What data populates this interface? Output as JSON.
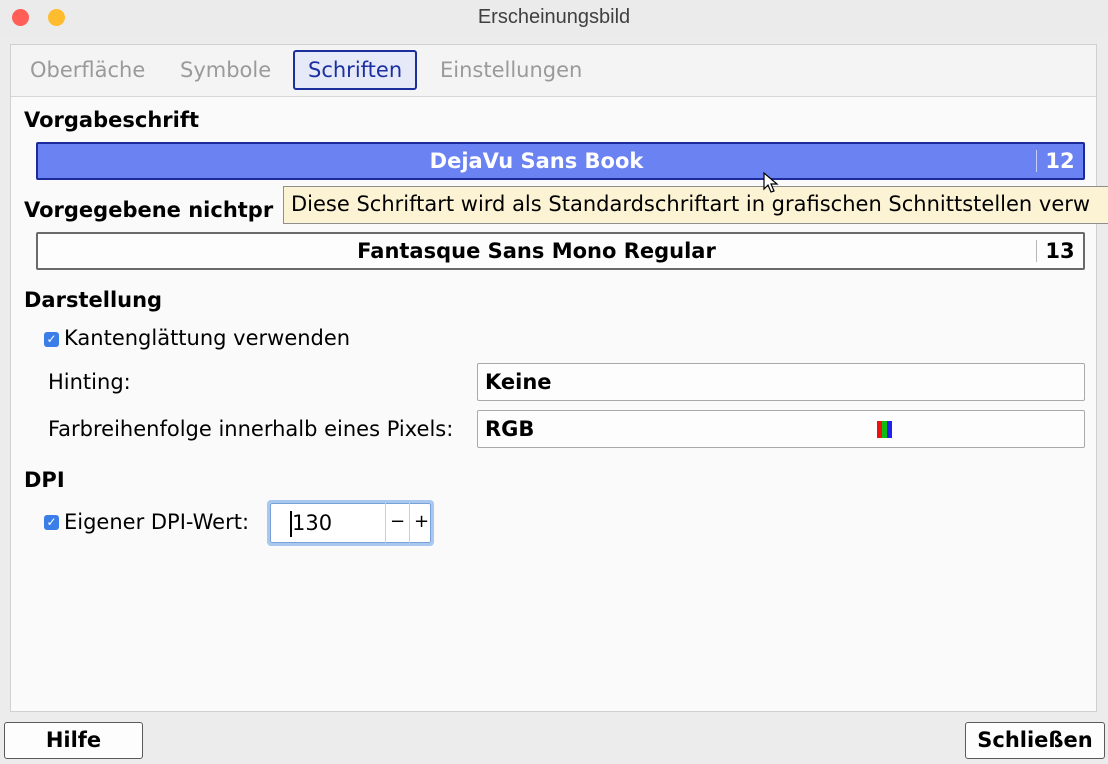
{
  "window": {
    "title": "Erscheinungsbild"
  },
  "tabs": [
    {
      "label": "Oberfläche"
    },
    {
      "label": "Symbole"
    },
    {
      "label": "Schriften",
      "active": true
    },
    {
      "label": "Einstellungen"
    }
  ],
  "default_font": {
    "heading": "Vorgabeschrift",
    "name": "DejaVu Sans Book",
    "size": "12"
  },
  "monospace_font": {
    "heading": "Vorgegebene nichtpr",
    "name": "Fantasque Sans Mono Regular",
    "size": "13"
  },
  "tooltip": {
    "text": "Diese Schriftart wird als Standardschriftart in grafischen Schnittstellen verw"
  },
  "rendering": {
    "heading": "Darstellung",
    "antialias_label": "Kantenglättung verwenden",
    "antialias_checked": true,
    "hinting_label": "Hinting:",
    "hinting_value": "Keine",
    "subpixel_label": "Farbreihenfolge innerhalb eines Pixels:",
    "subpixel_value": "RGB"
  },
  "dpi": {
    "heading": "DPI",
    "custom_label": "Eigener DPI-Wert:",
    "custom_checked": true,
    "value": "130",
    "minus": "−",
    "plus": "+"
  },
  "buttons": {
    "help": "Hilfe",
    "close": "Schließen"
  },
  "colors": {
    "active_accent": "#1c2e9c",
    "primary_button": "#6b82f2",
    "checkbox": "#3b7ee8",
    "tooltip_bg": "#fbf3d3"
  },
  "icons": {
    "checkbox": "check-icon",
    "swatch": "rgb-swatch-icon",
    "pointer": "mouse-pointer-icon"
  }
}
